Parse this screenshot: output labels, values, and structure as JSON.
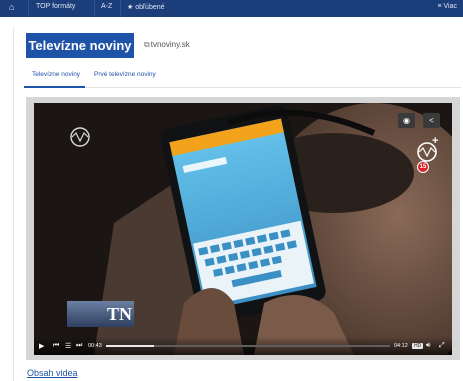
{
  "topbar": {
    "home_icon": "home-icon",
    "items": [
      "TOP formáty",
      "A-Z",
      "obľúbené"
    ],
    "favorites_icon": "star-icon",
    "more": "≡ Viac"
  },
  "brand": {
    "title": "Televízne noviny"
  },
  "external_link": {
    "icon": "external-link-icon",
    "label": "tvnoviny.sk"
  },
  "tabs": [
    {
      "label": "Televízne noviny",
      "active": true
    },
    {
      "label": "Prvé televízne noviny",
      "active": false
    }
  ],
  "player": {
    "channel_logo": "TN",
    "age_rating": "15",
    "current_time": "00:43",
    "duration": "04:12",
    "quality": "HD",
    "progress": 0.17
  },
  "content_link": "Obsah videa",
  "colors": {
    "brand_blue": "#1f53a7",
    "nav_blue": "#1b3d7a",
    "age_red": "#d9252b"
  }
}
